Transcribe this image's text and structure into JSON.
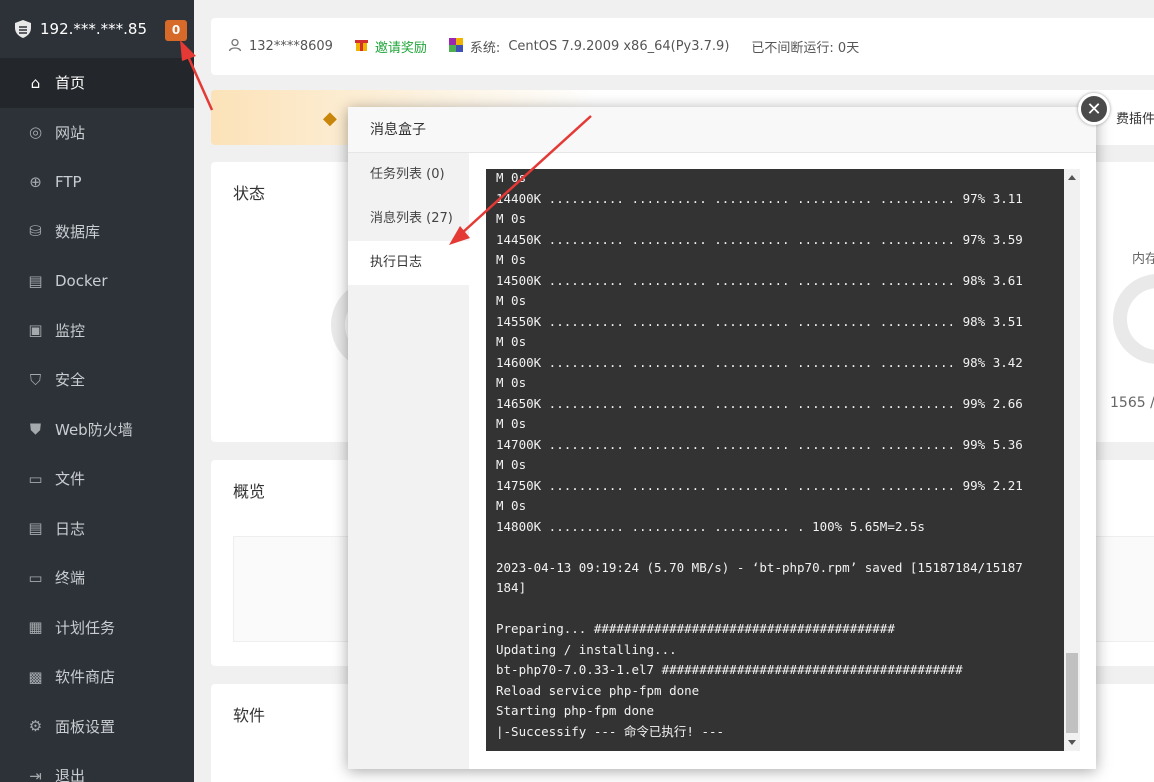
{
  "server": {
    "ip": "192.***.***.85",
    "badge": "0"
  },
  "sidebar": {
    "items": [
      {
        "label": "首页",
        "icon": "home-icon"
      },
      {
        "label": "网站",
        "icon": "globe-icon"
      },
      {
        "label": "FTP",
        "icon": "ftp-icon"
      },
      {
        "label": "数据库",
        "icon": "database-icon"
      },
      {
        "label": "Docker",
        "icon": "docker-icon"
      },
      {
        "label": "监控",
        "icon": "monitor-icon"
      },
      {
        "label": "安全",
        "icon": "shield-check-icon"
      },
      {
        "label": "Web防火墙",
        "icon": "firewall-shield-icon"
      },
      {
        "label": "文件",
        "icon": "folder-icon"
      },
      {
        "label": "日志",
        "icon": "log-icon"
      },
      {
        "label": "终端",
        "icon": "terminal-icon"
      },
      {
        "label": "计划任务",
        "icon": "calendar-icon"
      },
      {
        "label": "软件商店",
        "icon": "grid-icon"
      },
      {
        "label": "面板设置",
        "icon": "gear-icon"
      },
      {
        "label": "退出",
        "icon": "logout-icon"
      }
    ]
  },
  "topbar": {
    "user": "132****8609",
    "invite": "邀请奖励",
    "system_label": "系统:",
    "system_value": "CentOS 7.9.2009 x86_64(Py3.7.9)",
    "uptime": "已不间断运行: 0天"
  },
  "banner": {
    "plugin_text": "费插件"
  },
  "cards": {
    "status_title": "状态",
    "overview_title": "概览",
    "software_title": "软件",
    "memory_label": "内存",
    "memory_value": "1565 /"
  },
  "modal": {
    "title": "消息盒子",
    "tabs": [
      "任务列表 (0)",
      "消息列表 (27)",
      "执行日志"
    ],
    "active_tab": 2
  },
  "console": {
    "lines": [
      "M 0s",
      "14400K .......... .......... .......... .......... .......... 97% 3.11",
      "M 0s",
      "14450K .......... .......... .......... .......... .......... 97% 3.59",
      "M 0s",
      "14500K .......... .......... .......... .......... .......... 98% 3.61",
      "M 0s",
      "14550K .......... .......... .......... .......... .......... 98% 3.51",
      "M 0s",
      "14600K .......... .......... .......... .......... .......... 98% 3.42",
      "M 0s",
      "14650K .......... .......... .......... .......... .......... 99% 2.66",
      "M 0s",
      "14700K .......... .......... .......... .......... .......... 99% 5.36",
      "M 0s",
      "14750K .......... .......... .......... .......... .......... 99% 2.21",
      "M 0s",
      "14800K .......... .......... .......... . 100% 5.65M=2.5s",
      "",
      "2023-04-13 09:19:24 (5.70 MB/s) - ‘bt-php70.rpm’ saved [15187184/15187",
      "184]",
      "",
      "Preparing... ########################################",
      "Updating / installing...",
      "bt-php70-7.0.33-1.el7 ########################################",
      "Reload service php-fpm done",
      "Starting php-fpm done",
      "|-Successify --- 命令已执行! ---"
    ]
  },
  "colors": {
    "sidebar": "#2d3238",
    "accent_green": "#20a53a",
    "badge": "#d86a29",
    "arrow": "#e53935",
    "console_bg": "#333333"
  }
}
